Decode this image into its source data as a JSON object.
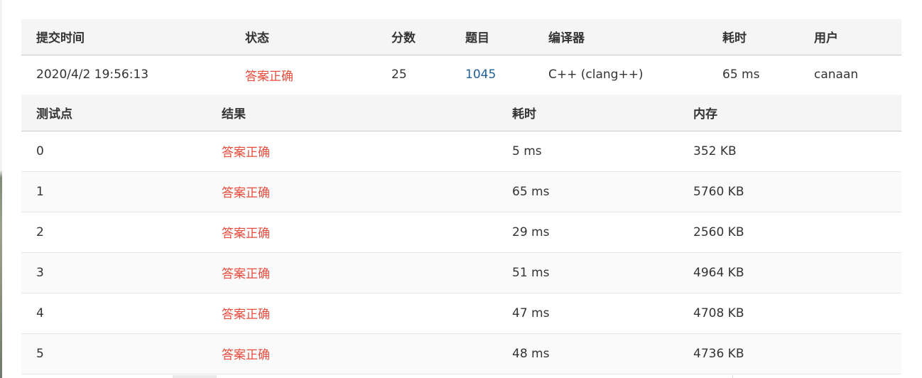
{
  "submission": {
    "headers": [
      "提交时间",
      "状态",
      "分数",
      "题目",
      "编译器",
      "耗时",
      "用户"
    ],
    "row": {
      "time": "2020/4/2 19:56:13",
      "status": "答案正确",
      "score": "25",
      "problem": "1045",
      "compiler": "C++ (clang++)",
      "duration": "65 ms",
      "user": "canaan"
    }
  },
  "testcases": {
    "headers": [
      "测试点",
      "结果",
      "耗时",
      "内存"
    ],
    "rows": [
      {
        "id": "0",
        "result": "答案正确",
        "time": "5 ms",
        "memory": "352 KB"
      },
      {
        "id": "1",
        "result": "答案正确",
        "time": "65 ms",
        "memory": "5760 KB"
      },
      {
        "id": "2",
        "result": "答案正确",
        "time": "29 ms",
        "memory": "2560 KB"
      },
      {
        "id": "3",
        "result": "答案正确",
        "time": "51 ms",
        "memory": "4964 KB"
      },
      {
        "id": "4",
        "result": "答案正确",
        "time": "47 ms",
        "memory": "4708 KB"
      },
      {
        "id": "5",
        "result": "答案正确",
        "time": "48 ms",
        "memory": "4736 KB"
      }
    ]
  },
  "colors": {
    "accepted": "#e74c3c",
    "link": "#1e5f99",
    "header_bg": "#f5f5f5"
  }
}
